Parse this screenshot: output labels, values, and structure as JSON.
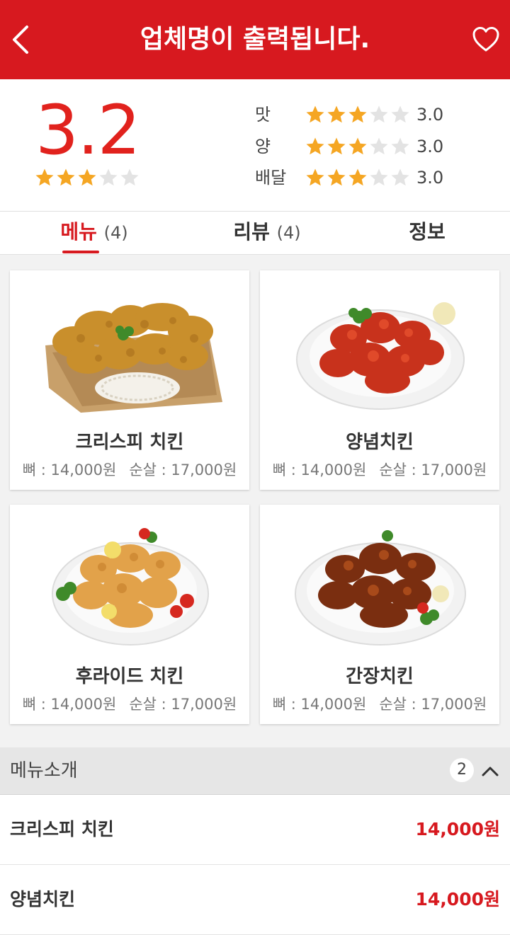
{
  "header": {
    "title": "업체명이 출력됩니다.",
    "back_icon": "chevron-left-icon",
    "favorite_icon": "heart-outline-icon",
    "color": "#d7191f"
  },
  "rating": {
    "overall": "3.2",
    "overall_stars": 3,
    "categories": [
      {
        "label": "맛",
        "stars": 3,
        "value": "3.0"
      },
      {
        "label": "양",
        "stars": 3,
        "value": "3.0"
      },
      {
        "label": "배달",
        "stars": 3,
        "value": "3.0"
      }
    ],
    "star_color": "#f5a623"
  },
  "tabs": [
    {
      "label": "메뉴",
      "count": "(4)",
      "active": true
    },
    {
      "label": "리뷰",
      "count": "(4)",
      "active": false
    },
    {
      "label": "정보",
      "count": "",
      "active": false
    }
  ],
  "menu_cards": [
    {
      "name": "크리스피 치킨",
      "bone": "뼈 : 14,000원",
      "boneless": "순살 : 17,000원",
      "image": "crispy-chicken-image"
    },
    {
      "name": "양념치킨",
      "bone": "뼈 : 14,000원",
      "boneless": "순살 : 17,000원",
      "image": "yangnyeom-chicken-image"
    },
    {
      "name": "후라이드 치킨",
      "bone": "뼈 : 14,000원",
      "boneless": "순살 : 17,000원",
      "image": "fried-chicken-image"
    },
    {
      "name": "간장치킨",
      "bone": "뼈 : 14,000원",
      "boneless": "순살 : 17,000원",
      "image": "soy-chicken-image"
    }
  ],
  "menu_section": {
    "title": "메뉴소개",
    "count": "2",
    "toggle_icon": "chevron-up-icon",
    "items": [
      {
        "name": "크리스피 치킨",
        "price": "14,000원"
      },
      {
        "name": "양념치킨",
        "price": "14,000원"
      }
    ]
  }
}
